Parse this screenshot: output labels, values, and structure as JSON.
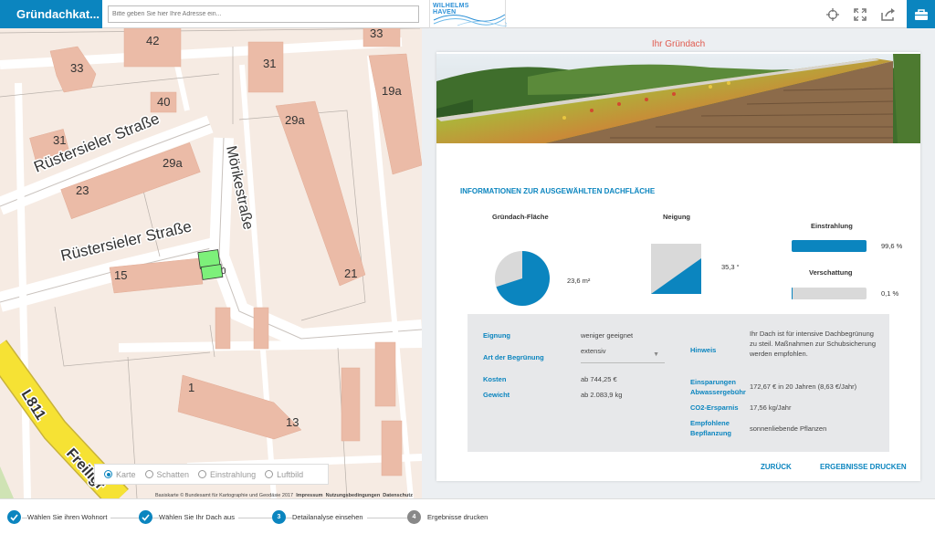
{
  "app": {
    "title": "Gründachkat...",
    "search_placeholder": "Bitte geben Sie hier Ihre Adresse ein...",
    "logo_text_1": "WILHELMS",
    "logo_text_2": "HAVEN",
    "accent": "#0b85bf"
  },
  "toolbar": {
    "icons": [
      "crosshair-icon",
      "fullscreen-icon",
      "share-icon",
      "toolbox-icon"
    ]
  },
  "map": {
    "street_labels": [
      "Rüstersieler Straße",
      "Rüstersieler Straße",
      "Mörikestraße",
      "L811",
      "Freiligr"
    ],
    "house_numbers": [
      "42",
      "33",
      "33",
      "31",
      "19a",
      "40",
      "31",
      "29a",
      "29a",
      "23",
      "15",
      "21",
      "1",
      "13",
      "0"
    ],
    "layers": [
      {
        "label": "Karte",
        "selected": true
      },
      {
        "label": "Schatten",
        "selected": false
      },
      {
        "label": "Einstrahlung",
        "selected": false
      },
      {
        "label": "Luftbild",
        "selected": false
      }
    ],
    "attribution": "Basiskarte © Bundesamt für Kartographie und Geodäsie 2017",
    "links": [
      "Impressum",
      "Nutzungsbedingungen",
      "Datenschutz"
    ]
  },
  "panel": {
    "title": "Ihr Gründach",
    "section_title": "INFORMATIONEN ZUR AUSGEWÄHLTEN DACHFLÄCHE",
    "area_label": "Gründach-Fläche",
    "area_value": "23,6 m²",
    "area_fraction": 0.7,
    "slope_label": "Neigung",
    "slope_value": "35,3 °",
    "irradiation_label": "Einstrahlung",
    "irradiation_value": "99,6 %",
    "irradiation_fraction": 0.996,
    "shading_label": "Verschattung",
    "shading_value": "0,1 %",
    "shading_fraction": 0.001
  },
  "details": {
    "suitability_label": "Eignung",
    "suitability_value": "weniger geeignet",
    "type_label": "Art der Begrünung",
    "type_value": "extensiv",
    "cost_label": "Kosten",
    "cost_value": "ab 744,25 €",
    "weight_label": "Gewicht",
    "weight_value": "ab 2.083,9 kg",
    "hint_label": "Hinweis",
    "hint_value": "Ihr Dach ist für intensive Dachbegrünung zu steil. Maßnahmen zur Schubsicherung werden empfohlen.",
    "savings_label": "Einsparungen Abwassergebühr",
    "savings_value": "172,67 € in 20 Jahren (8,63 €/Jahr)",
    "co2_label": "CO2-Ersparnis",
    "co2_value": "17,56 kg/Jahr",
    "plants_label": "Empfohlene Bepflanzung",
    "plants_value": "sonnenliebende Pflanzen"
  },
  "actions": {
    "back": "ZURÜCK",
    "print": "ERGEBNISSE DRUCKEN"
  },
  "steps": [
    {
      "label": "Wählen Sie ihren Wohnort",
      "state": "done"
    },
    {
      "label": "Wählen Sie Ihr Dach aus",
      "state": "done"
    },
    {
      "label": "Detailanalyse einsehen",
      "number": "3",
      "state": "active"
    },
    {
      "label": "Ergebnisse drucken",
      "number": "4",
      "state": "pending"
    }
  ]
}
